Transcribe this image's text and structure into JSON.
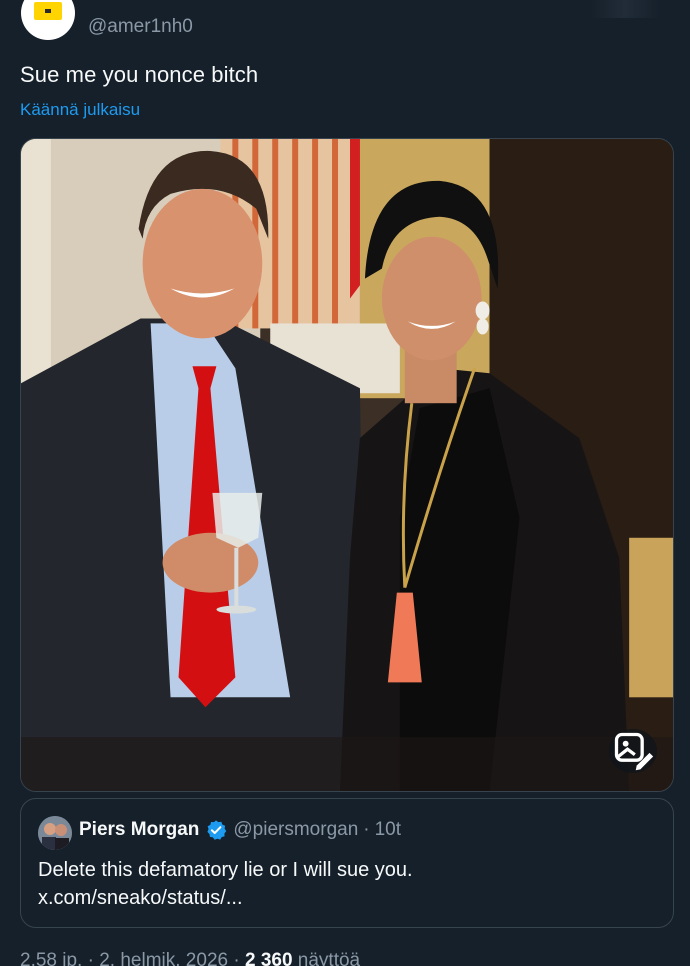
{
  "author": {
    "handle": "@amer1nh0"
  },
  "tweet": {
    "text": "Sue me you nonce bitch",
    "translate_label": "Käännä julkaisu"
  },
  "media": {
    "action_icon": "image-edit-icon"
  },
  "quote": {
    "name": "Piers Morgan",
    "handle": "@piersmorgan",
    "separator": "·",
    "time": "10t",
    "text_line1": "Delete this defamatory lie or I will sue you.",
    "text_line2": "x.com/sneako/status/..."
  },
  "meta": {
    "time": "2.58 ip.",
    "separator1": "·",
    "date": "2. helmik. 2026",
    "separator2": "·",
    "views_count": "2 360",
    "views_label": "näyttöä"
  },
  "colors": {
    "background": "#15202b",
    "link": "#1d9bf0",
    "secondary_text": "#8b98a5",
    "border": "#38444d",
    "verified": "#1d9bf0"
  }
}
